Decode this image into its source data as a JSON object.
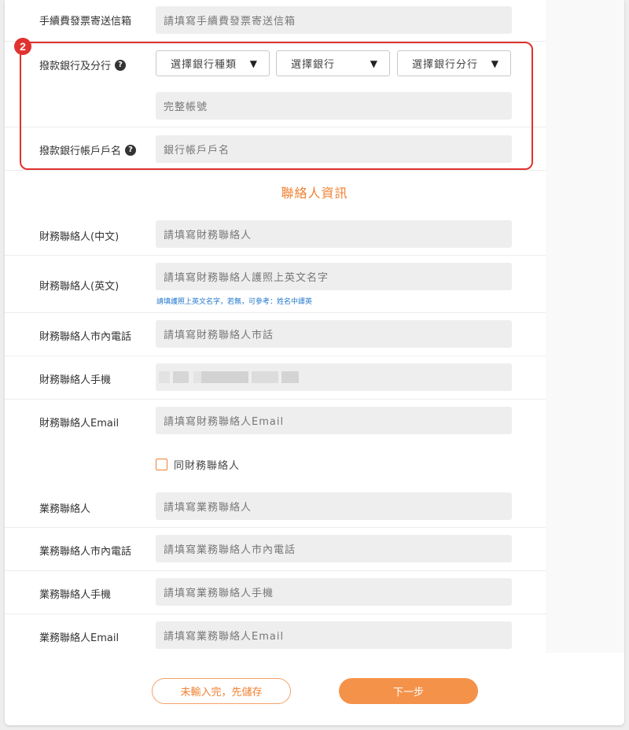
{
  "invoice": {
    "label": "手續費發票寄送信箱",
    "placeholder": "請填寫手續費發票寄送信箱"
  },
  "bank": {
    "badge": "2",
    "branch_label": "撥款銀行及分行",
    "help_glyph": "?",
    "selects": [
      "選擇銀行種類",
      "選擇銀行",
      "選擇銀行分行"
    ],
    "caret": "▼",
    "account_placeholder": "完整帳號",
    "holder_label": "撥款銀行帳戶戶名",
    "holder_placeholder": "銀行帳戶戶名"
  },
  "contact_section_title": "聯絡人資訊",
  "finance": {
    "name_zh_label": "財務聯絡人(中文)",
    "name_zh_placeholder": "請填寫財務聯絡人",
    "name_en_label": "財務聯絡人(英文)",
    "name_en_placeholder": "請填寫財務聯絡人護照上英文名字",
    "name_en_hint": "請填護照上英文名字，若無，可參考：姓名中譯英",
    "phone_label": "財務聯絡人市內電話",
    "phone_placeholder": "請填寫財務聯絡人市話",
    "mobile_label": "財務聯絡人手機",
    "email_label": "財務聯絡人Email",
    "email_placeholder": "請填寫財務聯絡人Email"
  },
  "same_as_finance_label": "同財務聯絡人",
  "business": {
    "name_label": "業務聯絡人",
    "name_placeholder": "請填寫業務聯絡人",
    "phone_label": "業務聯絡人市內電話",
    "phone_placeholder": "請填寫業務聯絡人市內電話",
    "mobile_label": "業務聯絡人手機",
    "mobile_placeholder": "請填寫業務聯絡人手機",
    "email_label": "業務聯絡人Email",
    "email_placeholder": "請填寫業務聯絡人Email"
  },
  "buttons": {
    "save_draft": "未輸入完，先儲存",
    "next": "下一步"
  },
  "colors": {
    "accent": "#f08030",
    "highlight": "#e0322f",
    "link": "#2277cc"
  }
}
